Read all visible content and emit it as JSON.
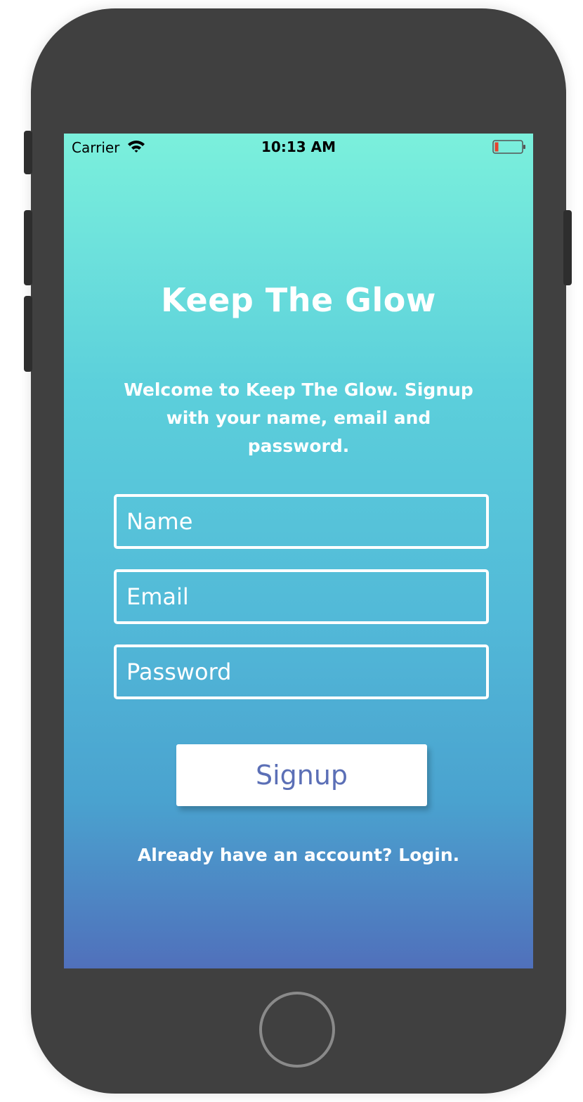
{
  "status_bar": {
    "carrier": "Carrier",
    "time": "10:13 AM",
    "wifi_icon": "wifi-icon",
    "battery_icon": "battery-low-icon"
  },
  "app": {
    "title": "Keep The Glow",
    "welcome_line1": "Welcome to Keep The Glow. Signup",
    "welcome_line2": "with your name, email and password."
  },
  "form": {
    "name_placeholder": "Name",
    "email_placeholder": "Email",
    "password_placeholder": "Password",
    "signup_label": "Signup",
    "login_text": "Already have an account? Login."
  },
  "colors": {
    "gradient_top": "#7bf0dc",
    "gradient_bottom": "#5070bb",
    "button_text": "#5b6fb6",
    "phone_body": "#404040"
  }
}
